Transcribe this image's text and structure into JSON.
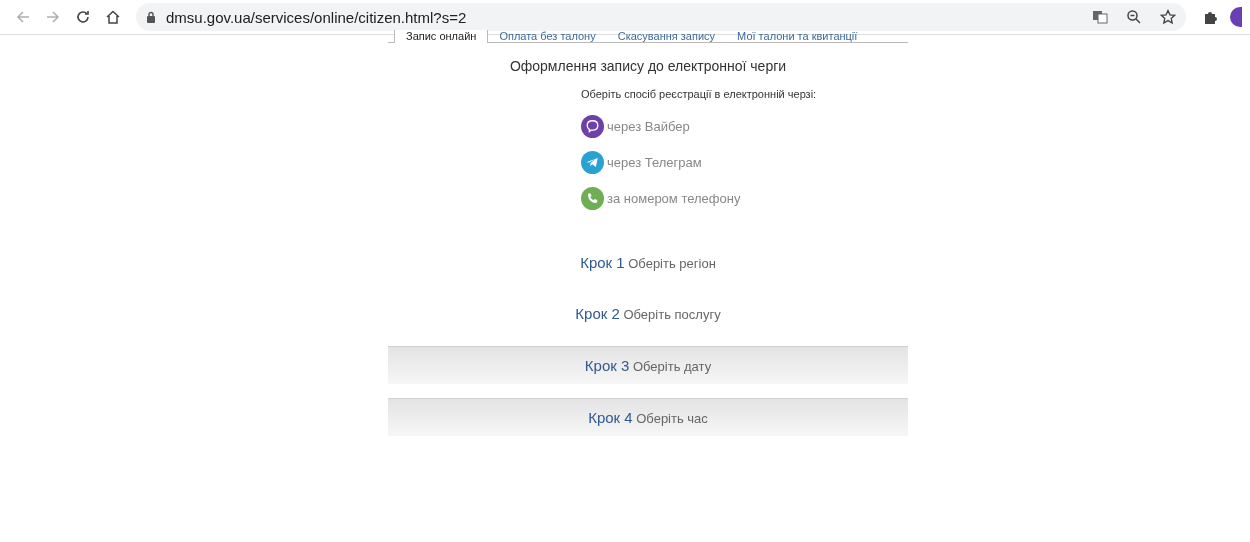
{
  "browser": {
    "url": "dmsu.gov.ua/services/online/citizen.html?s=2"
  },
  "tabs": [
    {
      "label": "Запис онлайн",
      "selected": true
    },
    {
      "label": "Оплата без талону",
      "selected": false
    },
    {
      "label": "Скасування запису",
      "selected": false
    },
    {
      "label": "Мої талони та квитанції",
      "selected": false
    }
  ],
  "heading": "Оформлення запису до електронної черги",
  "prompt": "Оберіть спосіб реєстрації в електронній черзі:",
  "options": [
    {
      "kind": "viber",
      "label": "через Вайбер",
      "color": "#6f3faa"
    },
    {
      "kind": "telegram",
      "label": "через Телеграм",
      "color": "#2aa1d3"
    },
    {
      "kind": "phone",
      "label": "за номером телефону",
      "color": "#6fae55"
    }
  ],
  "steps": [
    {
      "kind": "plain",
      "step": "Крок 1",
      "label": "Оберіть регіон"
    },
    {
      "kind": "plain",
      "step": "Крок 2",
      "label": "Оберіть послугу"
    },
    {
      "kind": "panel",
      "step": "Крок 3",
      "label": "Оберіть дату"
    },
    {
      "kind": "panel",
      "step": "Крок 4",
      "label": "Оберіть час"
    }
  ]
}
